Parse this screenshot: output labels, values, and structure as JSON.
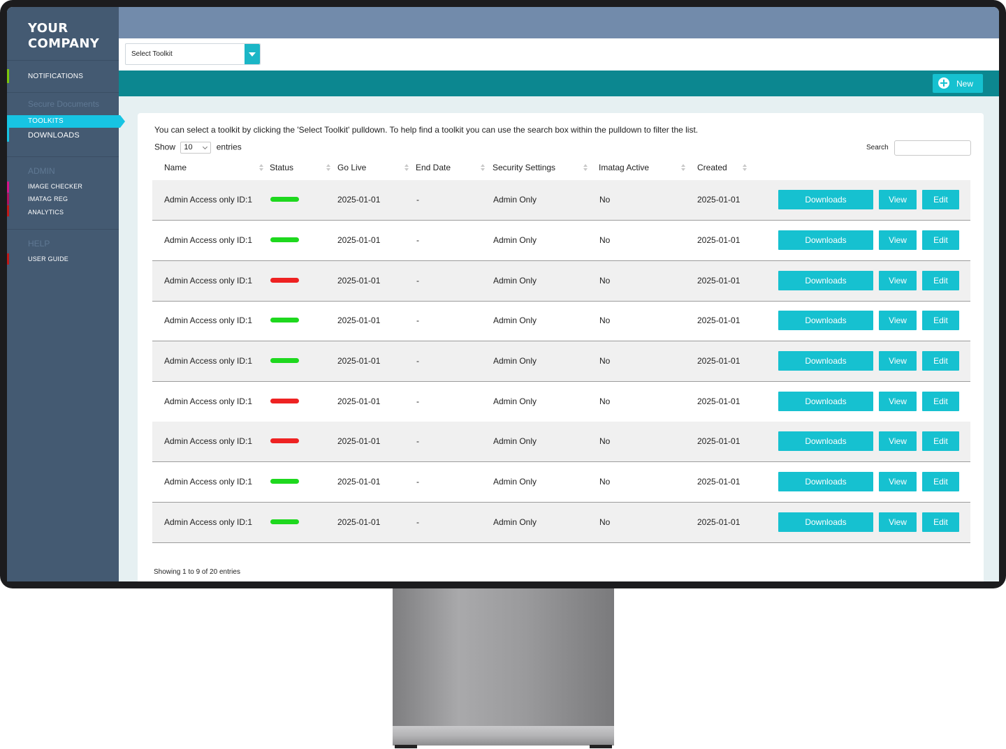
{
  "app": {
    "logo": "YOUR COMPANY",
    "logo_line1": "YOUR",
    "logo_line2": "COMPANY"
  },
  "sidebar": {
    "notifications": "NOTIFICATIONS",
    "secure_heading": "Secure Documents",
    "toolkits": "TOOLKITS",
    "downloads": "DOWNLOADS",
    "admin_heading": "ADMIN",
    "image_checker": "IMAGE CHECKER",
    "imatag_reg": "IMATAG REG",
    "analytics": "ANALYTICS",
    "help_heading": "HELP",
    "user_guide": "USER GUIDE"
  },
  "toolbar": {
    "select_toolkit": "Select Toolkit",
    "new_label": "New"
  },
  "card": {
    "intro": "You can select a toolkit by clicking the 'Select Toolkit' pulldown. To help find a toolkit you can use the search box within the pulldown to filter the list.",
    "show_label": "Show",
    "entries_value": "10",
    "entries_label": "entries",
    "search_label": "Search",
    "footer": "Showing 1 to 9 of 20 entries"
  },
  "table": {
    "headers": {
      "name": "Name",
      "status": "Status",
      "go_live": "Go Live",
      "end_date": "End Date",
      "security": "Security Settings",
      "imatag": "Imatag Active",
      "created": "Created"
    },
    "buttons": {
      "downloads": "Downloads",
      "view": "View",
      "edit": "Edit"
    },
    "rows": [
      {
        "name": "Admin Access only ID:1",
        "status": "active",
        "go_live": "2025-01-01",
        "end_date": "-",
        "security": "Admin Only",
        "imatag": "No",
        "created": "2025-01-01"
      },
      {
        "name": "Admin Access only ID:1",
        "status": "active",
        "go_live": "2025-01-01",
        "end_date": "-",
        "security": "Admin Only",
        "imatag": "No",
        "created": "2025-01-01"
      },
      {
        "name": "Admin Access only ID:1",
        "status": "inactive",
        "go_live": "2025-01-01",
        "end_date": "-",
        "security": "Admin Only",
        "imatag": "No",
        "created": "2025-01-01"
      },
      {
        "name": "Admin Access only ID:1",
        "status": "active",
        "go_live": "2025-01-01",
        "end_date": "-",
        "security": "Admin Only",
        "imatag": "No",
        "created": "2025-01-01"
      },
      {
        "name": "Admin Access only ID:1",
        "status": "active",
        "go_live": "2025-01-01",
        "end_date": "-",
        "security": "Admin Only",
        "imatag": "No",
        "created": "2025-01-01"
      },
      {
        "name": "Admin Access only ID:1",
        "status": "inactive",
        "go_live": "2025-01-01",
        "end_date": "-",
        "security": "Admin Only",
        "imatag": "No",
        "created": "2025-01-01"
      },
      {
        "name": "Admin Access only ID:1",
        "status": "inactive",
        "go_live": "2025-01-01",
        "end_date": "-",
        "security": "Admin Only",
        "imatag": "No",
        "created": "2025-01-01"
      },
      {
        "name": "Admin Access only ID:1",
        "status": "active",
        "go_live": "2025-01-01",
        "end_date": "-",
        "security": "Admin Only",
        "imatag": "No",
        "created": "2025-01-01"
      },
      {
        "name": "Admin Access only ID:1",
        "status": "active",
        "go_live": "2025-01-01",
        "end_date": "-",
        "security": "Admin Only",
        "imatag": "No",
        "created": "2025-01-01"
      }
    ]
  },
  "colors": {
    "accent": "#16c1d0",
    "teal_bar": "#0c8790",
    "sidebar": "#445a72",
    "status_active": "#1ed81e",
    "status_inactive": "#ee2222"
  }
}
